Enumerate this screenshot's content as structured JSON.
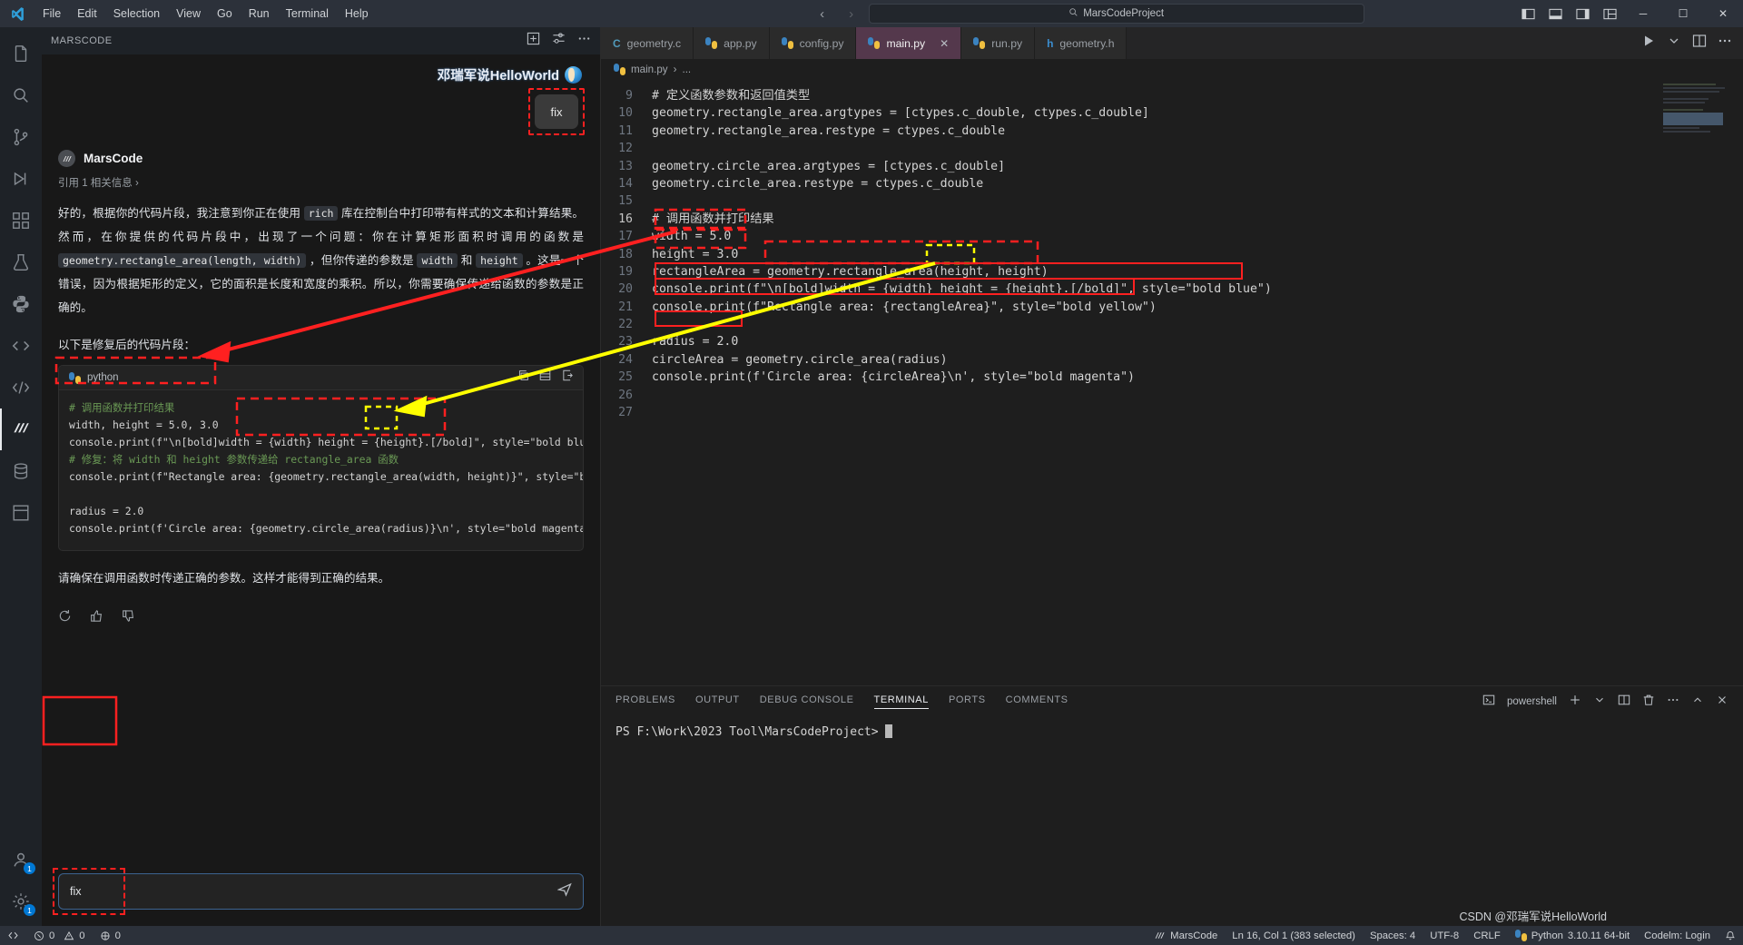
{
  "titlebar": {
    "menus": [
      "File",
      "Edit",
      "Selection",
      "View",
      "Go",
      "Run",
      "Terminal",
      "Help"
    ],
    "nav_back": "‹",
    "nav_forward": "›",
    "search_icon": "⌕",
    "search_value": "MarsCodeProject",
    "minimize": "─",
    "maximize": "☐",
    "close": "✕"
  },
  "activitybar": {
    "items": [
      {
        "name": "explorer",
        "badge": ""
      },
      {
        "name": "search",
        "badge": ""
      },
      {
        "name": "source-control",
        "badge": ""
      },
      {
        "name": "run-and-debug",
        "badge": ""
      },
      {
        "name": "extensions",
        "badge": ""
      },
      {
        "name": "testing",
        "badge": ""
      },
      {
        "name": "python",
        "badge": ""
      },
      {
        "name": "code",
        "badge": ""
      },
      {
        "name": "remote",
        "badge": ""
      },
      {
        "name": "marscode",
        "badge": ""
      },
      {
        "name": "database",
        "badge": ""
      },
      {
        "name": "layout",
        "badge": ""
      }
    ],
    "bottom": [
      {
        "name": "account",
        "badge": "1"
      },
      {
        "name": "settings",
        "badge": "1"
      }
    ]
  },
  "sidepanel": {
    "title": "MARSCODE",
    "watermark": "邓瑞军说HelloWorld",
    "fix_chip": "fix",
    "assistant_name": "MarsCode",
    "citation": "引用 1 相关信息 ›",
    "paragraph_parts": [
      "好的，根据你的代码片段，我注意到你正在使用 ",
      "rich",
      " 库在控制台中打印带有样式的文本和计算结果。然而，在你提供的代码片段中，出现了一个问题：你在计算矩形面积时调用的函数是 ",
      "geometry.rectangle_area(length, width)",
      " ，但你传递的参数是 ",
      "width",
      " 和 ",
      "height",
      " 。这是一个错误，因为根据矩形的定义，它的面积是长度和宽度的乘积。所以，你需要确保传递给函数的参数是正确的。"
    ],
    "intro_fixed": "以下是修复后的代码片段：",
    "codeblock": {
      "language": "python",
      "copy_icon": "copy-icon",
      "diff_icon": "diff-icon",
      "insert_icon": "insert-icon",
      "lines": [
        "# 调用函数并打印结果",
        "width, height = 5.0, 3.0",
        "console.print(f\"\\n[bold]width = {width} height = {height}.[/bold]\", style=\"bold blue\")",
        "# 修复：将 width 和 height 参数传递给 rectangle_area 函数",
        "console.print(f\"Rectangle area: {geometry.rectangle_area(width, height)}\", style=\"bold yellow\")",
        "",
        "radius = 2.0",
        "console.print(f'Circle area: {geometry.circle_area(radius)}\\n', style=\"bold magenta\")"
      ]
    },
    "closing": "请确保在调用函数时传递正确的参数。这样才能得到正确的结果。",
    "reactions": [
      "refresh-icon",
      "thumbs-up-icon",
      "thumbs-down-icon"
    ],
    "input_value": "fix",
    "send_icon": "send-icon"
  },
  "editor": {
    "tabs": [
      {
        "label": "geometry.c",
        "icon": "c-file-icon",
        "active": false,
        "closable": false
      },
      {
        "label": "app.py",
        "icon": "python-file-icon",
        "active": false,
        "closable": false
      },
      {
        "label": "config.py",
        "icon": "python-file-icon",
        "active": false,
        "closable": false
      },
      {
        "label": "main.py",
        "icon": "python-file-icon",
        "active": true,
        "closable": true
      },
      {
        "label": "run.py",
        "icon": "python-file-icon",
        "active": false,
        "closable": false
      },
      {
        "label": "geometry.h",
        "icon": "h-file-icon",
        "active": false,
        "closable": false
      }
    ],
    "tab_close": "✕",
    "actions": [
      "run-icon",
      "split-editor-icon",
      "more-icon"
    ],
    "breadcrumb": {
      "file": "main.py",
      "sep": "›",
      "tail": "..."
    },
    "lines": [
      {
        "n": 9,
        "text": "# 定义函数参数和返回值类型",
        "kind": "comment"
      },
      {
        "n": 10,
        "text": "geometry.rectangle_area.argtypes = [ctypes.c_double, ctypes.c_double]",
        "kind": "code"
      },
      {
        "n": 11,
        "text": "geometry.rectangle_area.restype = ctypes.c_double",
        "kind": "code"
      },
      {
        "n": 12,
        "text": "",
        "kind": "code"
      },
      {
        "n": 13,
        "text": "geometry.circle_area.argtypes = [ctypes.c_double]",
        "kind": "code"
      },
      {
        "n": 14,
        "text": "geometry.circle_area.restype = ctypes.c_double",
        "kind": "code"
      },
      {
        "n": 15,
        "text": "",
        "kind": "code"
      },
      {
        "n": 16,
        "text": "# 调用函数并打印结果",
        "kind": "comment"
      },
      {
        "n": 17,
        "text": "width = 5.0",
        "kind": "code"
      },
      {
        "n": 18,
        "text": "height = 3.0",
        "kind": "code"
      },
      {
        "n": 19,
        "text": "rectangleArea = geometry.rectangle_area(height, height)",
        "kind": "code"
      },
      {
        "n": 20,
        "text": "console.print(f\"\\n[bold]width = {width} height = {height}.[/bold]\", style=\"bold blue\")",
        "kind": "code"
      },
      {
        "n": 21,
        "text": "console.print(f\"Rectangle area: {rectangleArea}\", style=\"bold yellow\")",
        "kind": "code"
      },
      {
        "n": 22,
        "text": "",
        "kind": "code"
      },
      {
        "n": 23,
        "text": "radius = 2.0",
        "kind": "code"
      },
      {
        "n": 24,
        "text": "circleArea = geometry.circle_area(radius)",
        "kind": "code"
      },
      {
        "n": 25,
        "text": "console.print(f'Circle area: {circleArea}\\n', style=\"bold magenta\")",
        "kind": "code"
      },
      {
        "n": 26,
        "text": "",
        "kind": "code"
      },
      {
        "n": 27,
        "text": "",
        "kind": "code"
      }
    ]
  },
  "panel": {
    "tabs": [
      "PROBLEMS",
      "OUTPUT",
      "DEBUG CONSOLE",
      "TERMINAL",
      "PORTS",
      "COMMENTS"
    ],
    "selected": "TERMINAL",
    "shell": "powershell",
    "shell_icon": "powershell-icon",
    "actions": [
      "new-terminal-icon",
      "chevron-down-icon",
      "split-terminal-icon",
      "trash-icon",
      "more-icon",
      "chevron-up-icon",
      "close-icon"
    ],
    "prompt": "PS F:\\Work\\2023 Tool\\MarsCodeProject>"
  },
  "statusbar": {
    "remote_icon": "remote-icon",
    "errors_icon": "error-icon",
    "errors": "0",
    "warnings_icon": "warning-icon",
    "warnings": "0",
    "ports_icon": "ports-icon",
    "ports": "0",
    "marscode": "MarsCode",
    "cursor": "Ln 16, Col 1 (383 selected)",
    "spaces": "Spaces: 4",
    "encoding": "UTF-8",
    "eol": "CRLF",
    "language": "Python",
    "language_version": "3.10.11 64-bit",
    "bell_icon": "bell-icon",
    "watermark_small": "CSDN @邓瑞军说HelloWorld",
    "codelm_login": "Codelm: Login"
  },
  "annotations": {
    "color_red": "#ff2020",
    "color_yellow": "#ffff00",
    "boxes": [
      {
        "name": "fix-chip-box",
        "color": "#ff2020"
      },
      {
        "name": "chat-width-height-box",
        "color": "#ff2020"
      },
      {
        "name": "chat-rect-call-box",
        "color": "#ff2020"
      },
      {
        "name": "chat-args-box",
        "color": "#ffff00"
      },
      {
        "name": "editor-width-box",
        "color": "#ff2020"
      },
      {
        "name": "editor-height-box",
        "color": "#ff2020"
      },
      {
        "name": "editor-rect-call-box",
        "color": "#ff2020"
      },
      {
        "name": "editor-bad-arg-box",
        "color": "#ffff00"
      },
      {
        "name": "input-fix-box",
        "color": "#ff2020"
      }
    ]
  }
}
